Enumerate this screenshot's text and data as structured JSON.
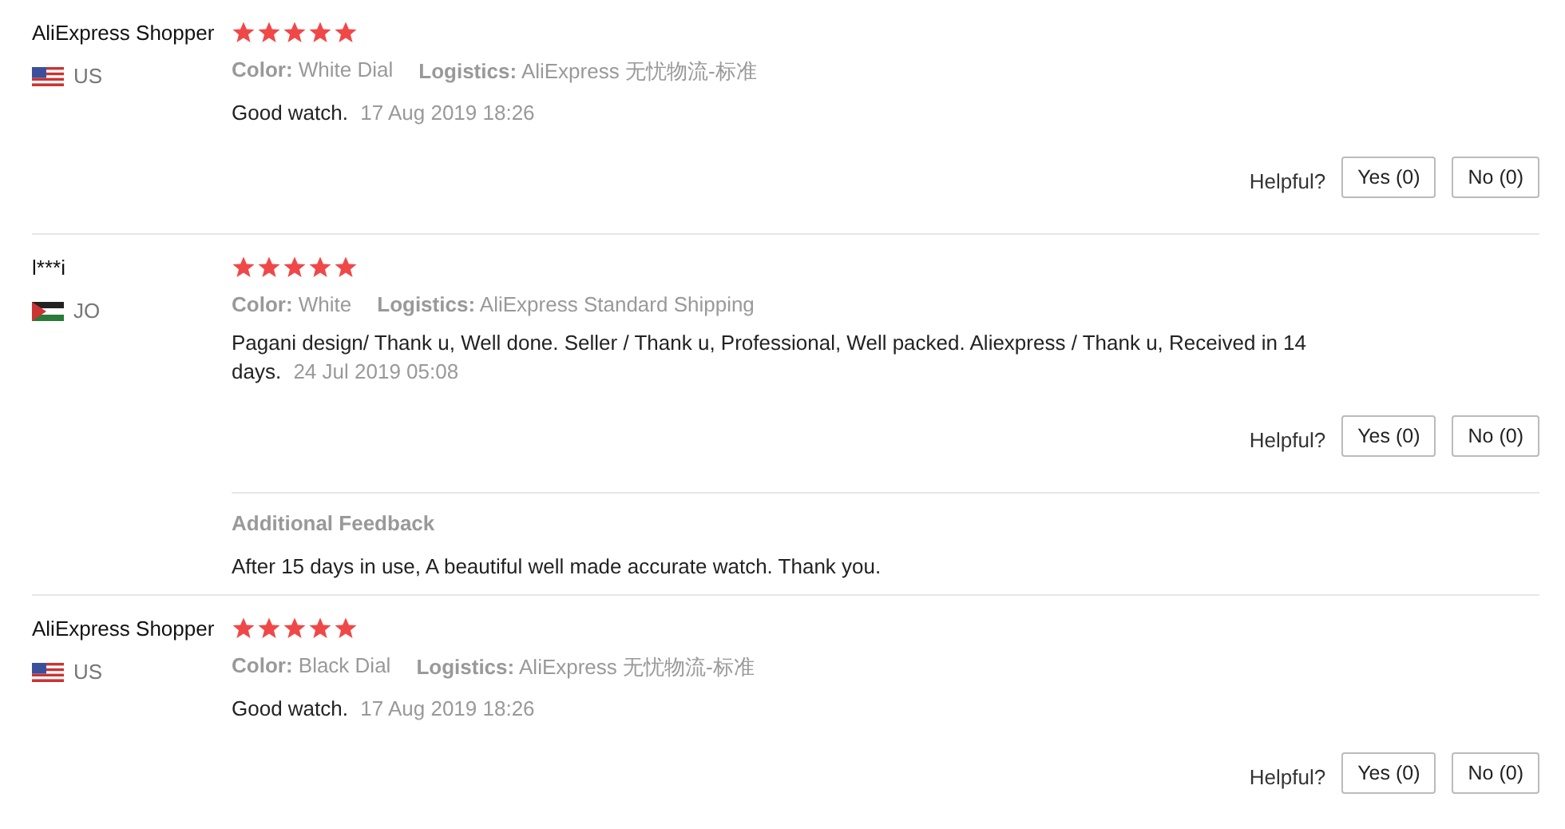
{
  "reviews": [
    {
      "reviewer": "AliExpress Shopper",
      "country": "US",
      "stars": 5,
      "attributes": [
        "**Color:** White Dial",
        "**Logistics:** AliExpress 无忧物流-标准"
      ],
      "text": "Good watch.",
      "date": "17 Aug 2019 18:26",
      "helpful_label": "Helpful?",
      "buttons": [
        "Yes (0)",
        "No (0)"
      ]
    },
    {
      "reviewer": "l***i",
      "country": "JO",
      "stars": 5,
      "attributes": [
        "**Color:** White",
        "**Logistics:** AliExpress Standard Shipping"
      ],
      "text": "Pagani design/ Thank u, Well done. Seller / Thank u, Professional, Well packed. Aliexpress / Thank u, Received in 14 days.",
      "date": "24 Jul 2019 05:08",
      "helpful_label": "Helpful?",
      "buttons": [
        "Yes (0)",
        "No (0)"
      ],
      "additional_feedback": {
        "title": "Additional Feedback",
        "text": "After 15 days in use, A beautiful well made accurate watch. Thank you."
      }
    },
    {
      "reviewer": "AliExpress Shopper",
      "country": "US",
      "stars": 5,
      "attributes": [
        "**Color:** Black Dial",
        "**Logistics:** AliExpress 无忧物流-标准"
      ],
      "text": "Good watch.",
      "date": "17 Aug 2019 18:26",
      "helpful_label": "Helpful?",
      "buttons": [
        "Yes (0)",
        "No (0)"
      ]
    }
  ]
}
